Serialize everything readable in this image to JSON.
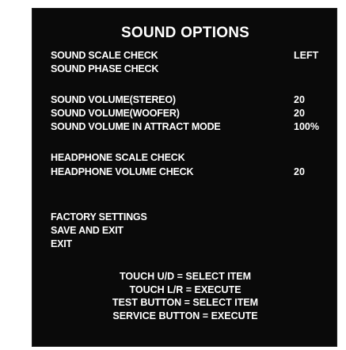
{
  "screen": {
    "title": "SOUND OPTIONS",
    "items": [
      {
        "label": "SOUND SCALE CHECK",
        "value": "LEFT"
      },
      {
        "label": "SOUND PHASE CHECK",
        "value": ""
      },
      {
        "label": "SOUND VOLUME(STEREO)",
        "value": "20"
      },
      {
        "label": "SOUND VOLUME(WOOFER)",
        "value": "20"
      },
      {
        "label": "SOUND VOLUME IN ATTRACT MODE",
        "value": "100%"
      },
      {
        "label": "HEADPHONE SCALE CHECK",
        "value": ""
      },
      {
        "label": "HEADPHONE VOLUME CHECK",
        "value": "20"
      },
      {
        "label": "FACTORY SETTINGS",
        "value": ""
      },
      {
        "label": "SAVE AND EXIT",
        "value": ""
      },
      {
        "label": "EXIT",
        "value": ""
      }
    ],
    "help": [
      "TOUCH U/D = SELECT ITEM",
      "TOUCH L/R = EXECUTE",
      "TEST BUTTON = SELECT ITEM",
      "SERVICE BUTTON = EXECUTE"
    ]
  },
  "colors": {
    "background": "#0a0a0a",
    "text": "#ffffff"
  }
}
